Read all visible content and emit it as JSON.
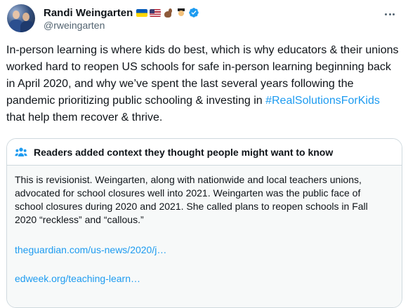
{
  "author": {
    "display_name": "Randi Weingarten",
    "handle": "@rweingarten",
    "name_emojis": [
      "ukraine-flag-icon",
      "us-flag-icon",
      "flexed-biceps-icon",
      "teacher-icon"
    ],
    "verified": true
  },
  "tweet": {
    "text_before_hashtag": "In-person learning is where kids do best, which is why educators & their unions worked hard to reopen US schools for safe in-person learning beginning back in April 2020, and why we’ve spent the last several years following the pandemic prioritizing public schooling & investing in ",
    "hashtag": "#RealSolutionsForKids",
    "text_after_hashtag": " that help them recover & thrive."
  },
  "community_note": {
    "title": "Readers added context they thought people might want to know",
    "text": "This is revisionist. Weingarten, along with nationwide and local teachers unions, advocated for school closures well into 2021. Weingarten was the public face of school closures during 2020 and 2021. She called plans to reopen schools in Fall 2020 “reckless” and “callous.”",
    "links": [
      "theguardian.com/us-news/2020/j…",
      "edweek.org/teaching-learn…"
    ]
  },
  "colors": {
    "text": "#0f1419",
    "secondary": "#536471",
    "link": "#1d9bf0",
    "verified": "#1d9bf0",
    "note_background": "#f7f9f9",
    "border": "#cfd9de"
  }
}
